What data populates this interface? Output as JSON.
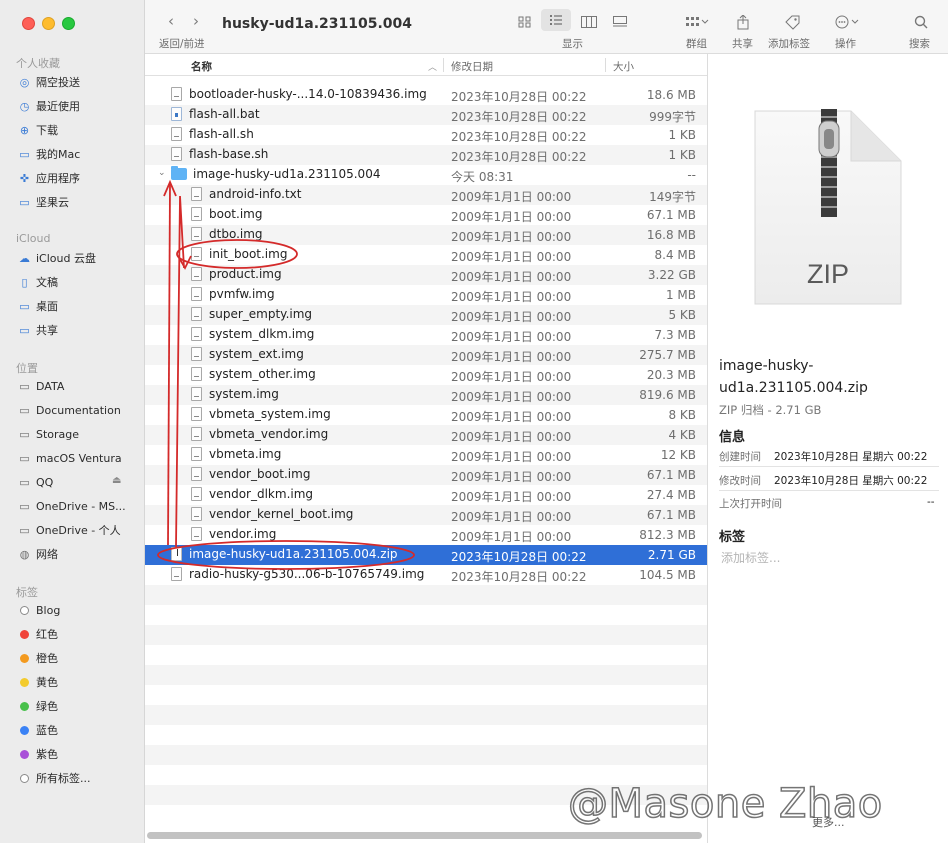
{
  "window": {
    "title": "husky-ud1a.231105.004",
    "nav_caption": "返回/前进",
    "back_icon": "‹",
    "forward_icon": "›"
  },
  "toolbar": {
    "view_label": "显示",
    "group_label": "群组",
    "share_label": "共享",
    "tags_label": "添加标签",
    "action_label": "操作",
    "search_label": "搜索"
  },
  "sidebar": {
    "favorites_title": "个人收藏",
    "favorites": [
      {
        "label": "隔空投送",
        "icon": "airdrop-icon"
      },
      {
        "label": "最近使用",
        "icon": "clock-icon"
      },
      {
        "label": "下载",
        "icon": "download-icon"
      },
      {
        "label": "我的Mac",
        "icon": "folder-icon"
      },
      {
        "label": "应用程序",
        "icon": "apps-icon"
      },
      {
        "label": "坚果云",
        "icon": "folder-icon"
      }
    ],
    "icloud_title": "iCloud",
    "icloud": [
      {
        "label": "iCloud 云盘",
        "icon": "cloud-icon"
      },
      {
        "label": "文稿",
        "icon": "document-icon"
      },
      {
        "label": "桌面",
        "icon": "desktop-icon"
      },
      {
        "label": "共享",
        "icon": "shared-folder-icon"
      }
    ],
    "locations_title": "位置",
    "locations": [
      {
        "label": "DATA",
        "icon": "disk-icon"
      },
      {
        "label": "Documentation",
        "icon": "disk-icon"
      },
      {
        "label": "Storage",
        "icon": "disk-icon"
      },
      {
        "label": "macOS Ventura",
        "icon": "disk-icon"
      },
      {
        "label": "QQ",
        "icon": "disk-icon"
      },
      {
        "label": "OneDrive - MS...",
        "icon": "disk-icon"
      },
      {
        "label": "OneDrive - 个人",
        "icon": "disk-icon"
      },
      {
        "label": "网络",
        "icon": "network-icon"
      }
    ],
    "tags_title": "标签",
    "tags": [
      {
        "label": "Blog",
        "color": "#ffffff"
      },
      {
        "label": "红色",
        "color": "#f0443a"
      },
      {
        "label": "橙色",
        "color": "#f39a1f"
      },
      {
        "label": "黄色",
        "color": "#f3cb2d"
      },
      {
        "label": "绿色",
        "color": "#48c04b"
      },
      {
        "label": "蓝色",
        "color": "#3b82f5"
      },
      {
        "label": "紫色",
        "color": "#a950d8"
      },
      {
        "label": "所有标签...",
        "color": ""
      }
    ]
  },
  "columns": {
    "name": "名称",
    "date": "修改日期",
    "size": "大小"
  },
  "files": [
    {
      "name": "bootloader-husky-...14.0-10839436.img",
      "date": "2023年10月28日 00:22",
      "size": "18.6 MB",
      "indent": 0,
      "kind": "file"
    },
    {
      "name": "flash-all.bat",
      "date": "2023年10月28日 00:22",
      "size": "999字节",
      "indent": 0,
      "kind": "win"
    },
    {
      "name": "flash-all.sh",
      "date": "2023年10月28日 00:22",
      "size": "1 KB",
      "indent": 0,
      "kind": "file"
    },
    {
      "name": "flash-base.sh",
      "date": "2023年10月28日 00:22",
      "size": "1 KB",
      "indent": 0,
      "kind": "file"
    },
    {
      "name": "image-husky-ud1a.231105.004",
      "date": "今天 08:31",
      "size": "--",
      "indent": 0,
      "kind": "folder"
    },
    {
      "name": "android-info.txt",
      "date": "2009年1月1日 00:00",
      "size": "149字节",
      "indent": 1,
      "kind": "file"
    },
    {
      "name": "boot.img",
      "date": "2009年1月1日 00:00",
      "size": "67.1 MB",
      "indent": 1,
      "kind": "file"
    },
    {
      "name": "dtbo.img",
      "date": "2009年1月1日 00:00",
      "size": "16.8 MB",
      "indent": 1,
      "kind": "file"
    },
    {
      "name": "init_boot.img",
      "date": "2009年1月1日 00:00",
      "size": "8.4 MB",
      "indent": 1,
      "kind": "file"
    },
    {
      "name": "product.img",
      "date": "2009年1月1日 00:00",
      "size": "3.22 GB",
      "indent": 1,
      "kind": "file"
    },
    {
      "name": "pvmfw.img",
      "date": "2009年1月1日 00:00",
      "size": "1 MB",
      "indent": 1,
      "kind": "file"
    },
    {
      "name": "super_empty.img",
      "date": "2009年1月1日 00:00",
      "size": "5 KB",
      "indent": 1,
      "kind": "file"
    },
    {
      "name": "system_dlkm.img",
      "date": "2009年1月1日 00:00",
      "size": "7.3 MB",
      "indent": 1,
      "kind": "file"
    },
    {
      "name": "system_ext.img",
      "date": "2009年1月1日 00:00",
      "size": "275.7 MB",
      "indent": 1,
      "kind": "file"
    },
    {
      "name": "system_other.img",
      "date": "2009年1月1日 00:00",
      "size": "20.3 MB",
      "indent": 1,
      "kind": "file"
    },
    {
      "name": "system.img",
      "date": "2009年1月1日 00:00",
      "size": "819.6 MB",
      "indent": 1,
      "kind": "file"
    },
    {
      "name": "vbmeta_system.img",
      "date": "2009年1月1日 00:00",
      "size": "8 KB",
      "indent": 1,
      "kind": "file"
    },
    {
      "name": "vbmeta_vendor.img",
      "date": "2009年1月1日 00:00",
      "size": "4 KB",
      "indent": 1,
      "kind": "file"
    },
    {
      "name": "vbmeta.img",
      "date": "2009年1月1日 00:00",
      "size": "12 KB",
      "indent": 1,
      "kind": "file"
    },
    {
      "name": "vendor_boot.img",
      "date": "2009年1月1日 00:00",
      "size": "67.1 MB",
      "indent": 1,
      "kind": "file"
    },
    {
      "name": "vendor_dlkm.img",
      "date": "2009年1月1日 00:00",
      "size": "27.4 MB",
      "indent": 1,
      "kind": "file"
    },
    {
      "name": "vendor_kernel_boot.img",
      "date": "2009年1月1日 00:00",
      "size": "67.1 MB",
      "indent": 1,
      "kind": "file"
    },
    {
      "name": "vendor.img",
      "date": "2009年1月1日 00:00",
      "size": "812.3 MB",
      "indent": 1,
      "kind": "file"
    },
    {
      "name": "image-husky-ud1a.231105.004.zip",
      "date": "2023年10月28日 00:22",
      "size": "2.71 GB",
      "indent": 0,
      "kind": "zip",
      "selected": true
    },
    {
      "name": "radio-husky-g530...06-b-10765749.img",
      "date": "2023年10月28日 00:22",
      "size": "104.5 MB",
      "indent": 0,
      "kind": "file"
    }
  ],
  "preview": {
    "icon_text": "ZIP",
    "title_line1": "image-husky-",
    "title_line2": "ud1a.231105.004.zip",
    "subtitle": "ZIP 归档 - 2.71 GB",
    "info_title": "信息",
    "created_label": "创建时间",
    "created_value": "2023年10月28日 星期六 00:22",
    "modified_label": "修改时间",
    "modified_value": "2023年10月28日 星期六 00:22",
    "opened_label": "上次打开时间",
    "opened_value": "--",
    "tags_title": "标签",
    "tags_placeholder": "添加标签...",
    "more_label": "更多..."
  },
  "watermark": "@Masone Zhao"
}
